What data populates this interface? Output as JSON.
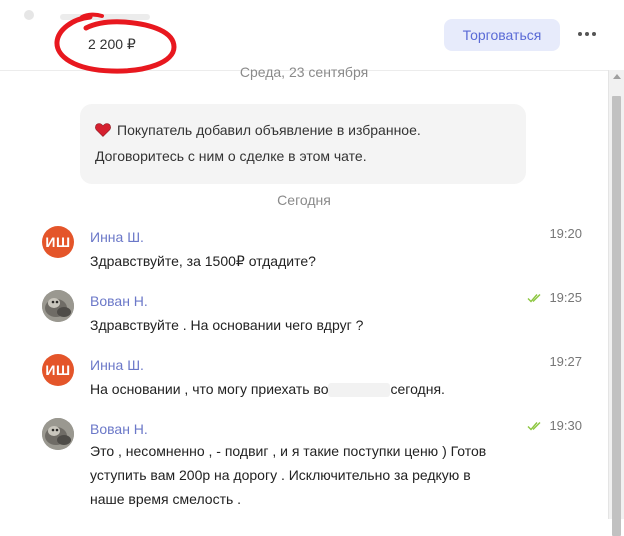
{
  "header": {
    "price": "2 200 ₽",
    "bargain_button": "Торговаться"
  },
  "date_separators": {
    "first": "Среда, 23 сентября",
    "second": "Сегодня"
  },
  "system_message": {
    "line1": "Покупатель добавил объявление в избранное.",
    "line2": "Договоритесь с ним о сделке в этом чате."
  },
  "messages": [
    {
      "author": "Инна Ш.",
      "avatar_initials": "ИШ",
      "time": "19:20",
      "text": "Здравствуйте, за 1500₽ отдадите?"
    },
    {
      "author": "Вован Н.",
      "time": "19:25",
      "status": "read",
      "text": "Здравствуйте . На основании чего вдруг ?"
    },
    {
      "author": "Инна Ш.",
      "avatar_initials": "ИШ",
      "time": "19:27",
      "text_before": "На основании , что могу приехать во",
      "text_after": "сегодня."
    },
    {
      "author": "Вован Н.",
      "time": "19:30",
      "status": "read",
      "lines": [
        "Это , несомненно , - подвиг , и я такие поступки ценю ) Готов",
        "уступить вам 200р на дорогу . Исключительно за редкую в",
        "наше время смелость ."
      ]
    }
  ],
  "colors": {
    "accent": "#6b78c8",
    "button_bg": "#e7ebfb",
    "avatar_initials_bg": "#e4552a",
    "read_check": "#8cc63f",
    "annotation": "#e8181f"
  }
}
